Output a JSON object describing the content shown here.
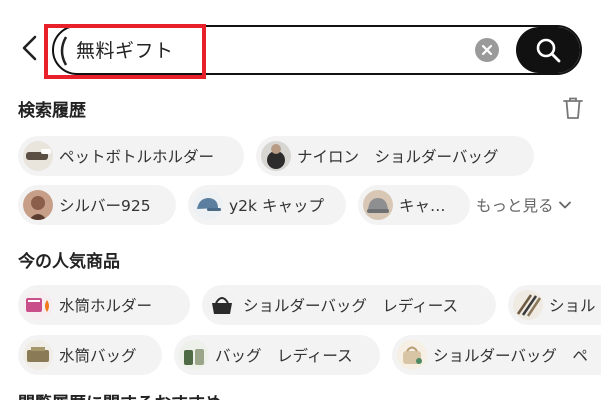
{
  "search": {
    "value": "無料ギフト"
  },
  "history": {
    "title": "検索履歴",
    "items": [
      {
        "label": "ペットボトルホルダー",
        "thumb": "bottle-holder"
      },
      {
        "label": "ナイロン　ショルダーバッグ",
        "thumb": "nylon-bag"
      },
      {
        "label": "シルバー925",
        "thumb": "silver-925"
      },
      {
        "label": "y2k キャップ",
        "thumb": "cap"
      },
      {
        "label": "キャ…",
        "thumb": "cap-grey"
      }
    ],
    "more_label": "もっと見る"
  },
  "popular": {
    "title": "今の人気商品",
    "items": [
      {
        "label": "水筒ホルダー",
        "thumb": "bottle-holder"
      },
      {
        "label": "ショルダーバッグ　レディース",
        "thumb": "black-bag"
      },
      {
        "label": "ショル",
        "thumb": "pens"
      },
      {
        "label": "水筒バッグ",
        "thumb": "bottle-bag"
      },
      {
        "label": "バッグ　レディース",
        "thumb": "green-bag"
      },
      {
        "label": "ショルダーバッグ　ペ",
        "thumb": "cream-bag"
      }
    ]
  },
  "next_section": {
    "title": "閲覧履歴に関するおすすめ"
  },
  "colors": {
    "highlight": "#e8202a",
    "search_button": "#111111",
    "chip_background": "#f3f3f3"
  }
}
